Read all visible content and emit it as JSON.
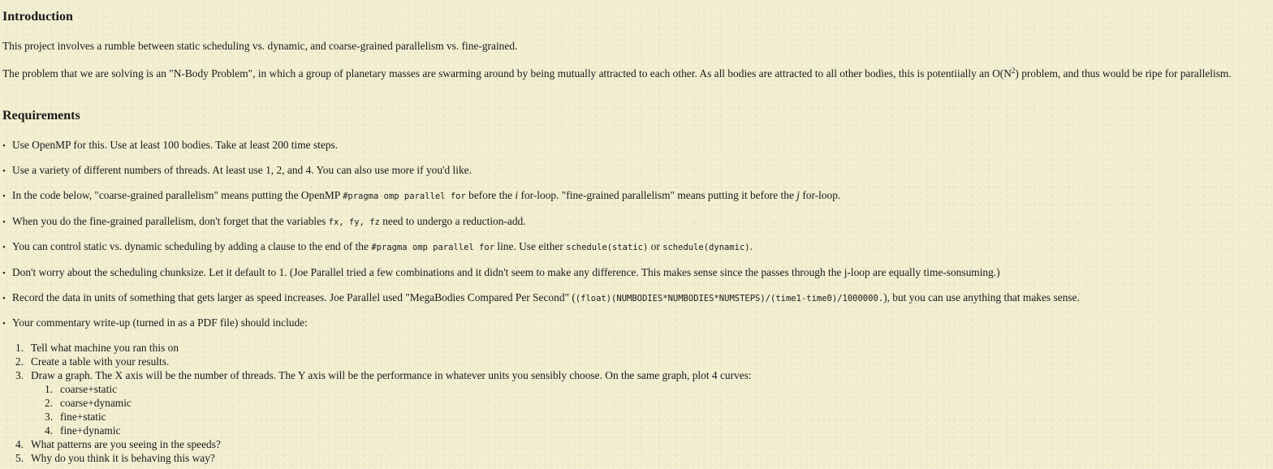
{
  "intro": {
    "heading": "Introduction",
    "p1": "This project involves a rumble between static scheduling vs. dynamic, and coarse-grained parallelism vs. fine-grained.",
    "p2_part1": "The problem that we are solving is an \"N-Body Problem\", in which a group of planetary masses are swarming around by being mutually attracted to each other. As all bodies are attracted to all other bodies, this is potentiially an O(N",
    "p2_sup": "2",
    "p2_part2": ") problem, and thus would be ripe for parallelism."
  },
  "requirements": {
    "heading": "Requirements",
    "bullet": "•",
    "item1": "Use OpenMP for this. Use at least 100 bodies. Take at least 200 time steps.",
    "item2": "Use a variety of different numbers of threads. At least use 1, 2, and 4. You can also use more if you'd like.",
    "item3": {
      "a": "In the code below, \"coarse-grained parallelism\" means putting the OpenMP ",
      "code1": "#pragma omp parallel for",
      "b": " before the ",
      "i": "i",
      "c": " for-loop. \"fine-grained parallelism\" means putting it before the ",
      "j": "j",
      "d": " for-loop."
    },
    "item4": {
      "a": "When you do the fine-grained parallelism, don't forget that the variables ",
      "code1": "fx, fy, fz",
      "b": " need to undergo a reduction-add."
    },
    "item5": {
      "a": "You can control static vs. dynamic scheduling by adding a clause to the end of the ",
      "code1": "#pragma omp parallel for",
      "b": " line. Use either ",
      "code2": "schedule(static)",
      "c": " or ",
      "code3": "schedule(dynamic)",
      "d": "."
    },
    "item6": "Don't worry about the scheduling chunksize. Let it default to 1. (Joe Parallel tried a few combinations and it didn't seem to make any difference. This makes sense since the passes through the j-loop are equally time-sonsuming.)",
    "item7": {
      "a": "Record the data in units of something that gets larger as speed increases. Joe Parallel used \"MegaBodies Compared Per Second\" (",
      "code1": "(float)(NUMBODIES*NUMBODIES*NUMSTEPS)/(time1-time0)/1000000.",
      "b": "), but you can use anything that makes sense."
    },
    "item8": "Your commentary write-up (turned in as a PDF file) should include:"
  },
  "writeup": {
    "n1": "1.",
    "t1": "Tell what machine you ran this on",
    "n2": "2.",
    "t2": "Create a table with your results.",
    "n3": "3.",
    "t3": "Draw a graph. The X axis will be the number of threads. The Y axis will be the performance in whatever units you sensibly choose. On the same graph, plot 4 curves:",
    "sub": {
      "n1": "1.",
      "t1": "coarse+static",
      "n2": "2.",
      "t2": "coarse+dynamic",
      "n3": "3.",
      "t3": "fine+static",
      "n4": "4.",
      "t4": "fine+dynamic"
    },
    "n4": "4.",
    "t4": "What patterns are you seeing in the speeds?",
    "n5": "5.",
    "t5": "Why do you think it is behaving this way?"
  }
}
